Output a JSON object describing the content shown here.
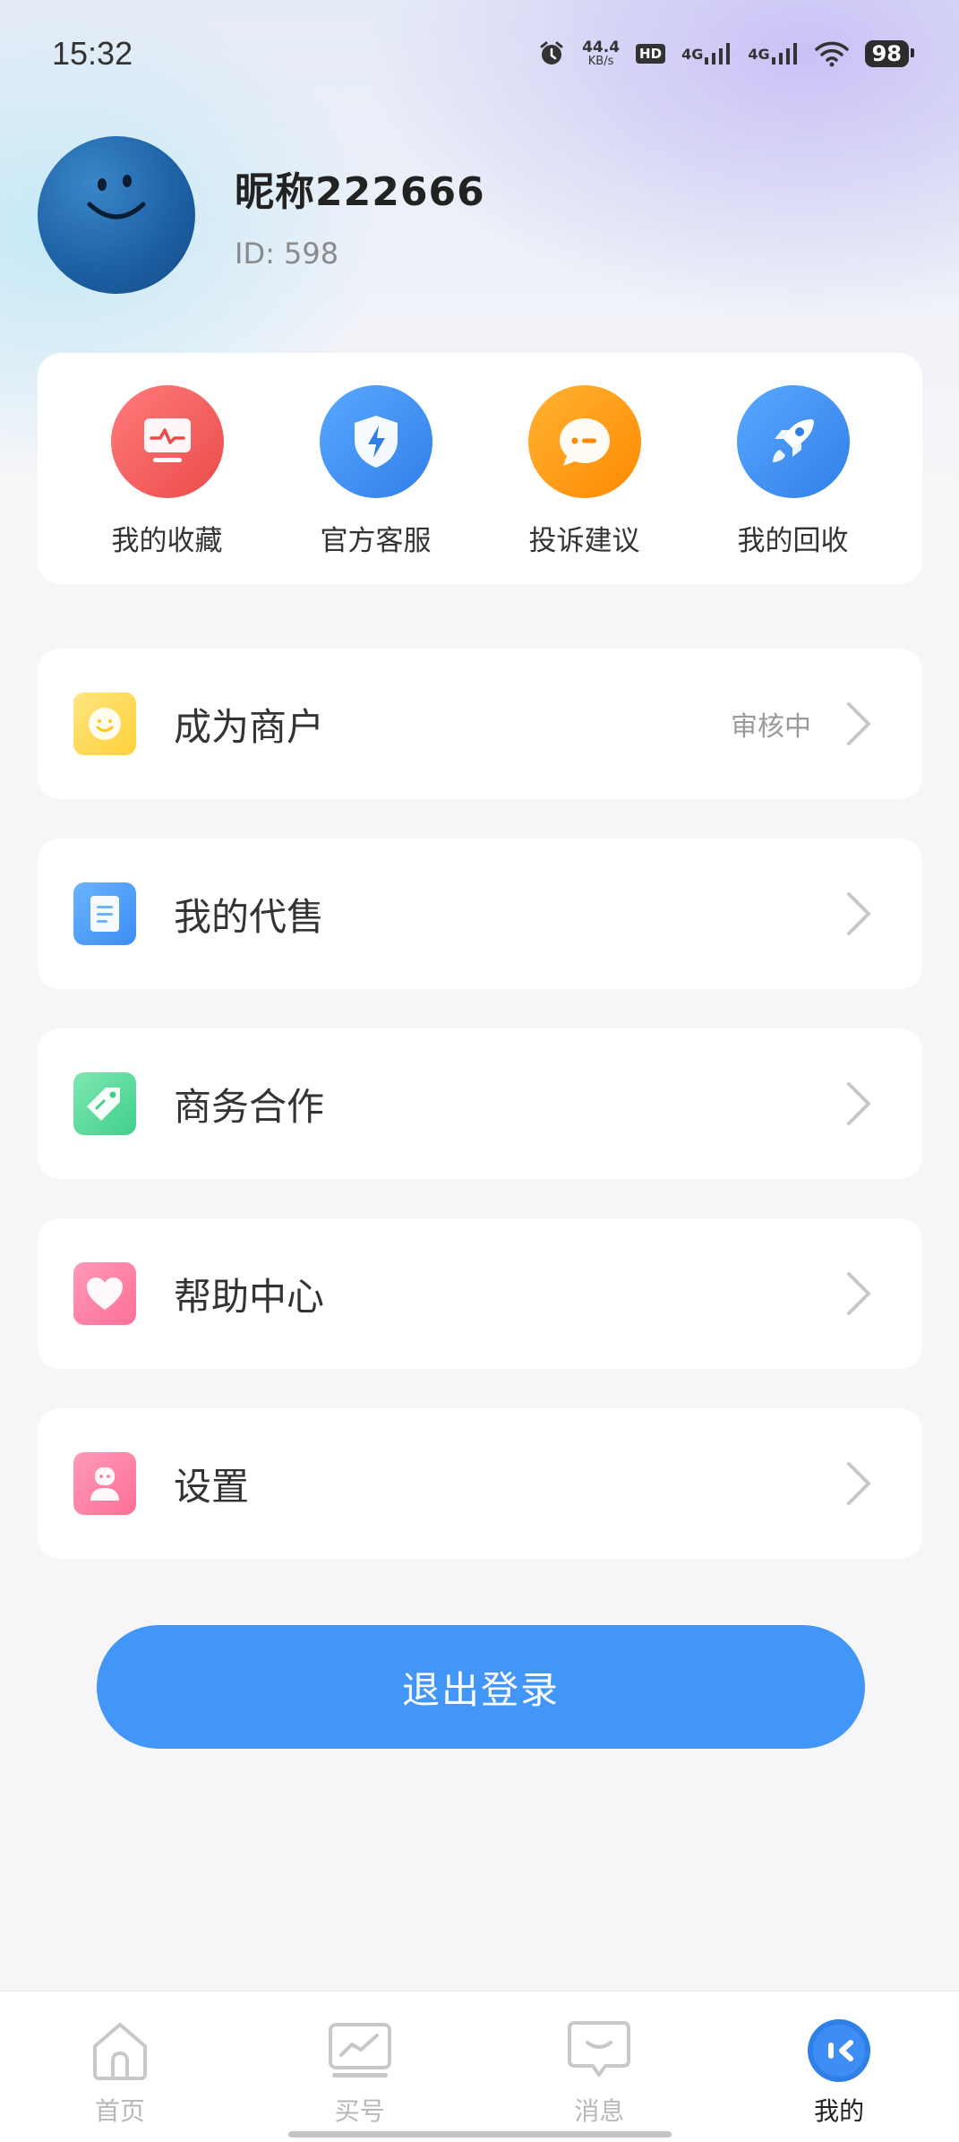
{
  "status_bar": {
    "time": "15:32",
    "net_speed_value": "44.4",
    "net_speed_unit": "KB/s",
    "hd_label": "HD",
    "sig1_label": "4G",
    "sig2_label": "4G",
    "battery": "98"
  },
  "profile": {
    "nickname": "昵称222666",
    "user_id": "ID: 598"
  },
  "quick_actions": [
    {
      "label": "我的收藏",
      "icon": "monitor-icon",
      "color": "#f05a5a"
    },
    {
      "label": "官方客服",
      "icon": "shield-bolt-icon",
      "color": "#3d8df5"
    },
    {
      "label": "投诉建议",
      "icon": "chat-bubble-icon",
      "color": "#ff9c1a"
    },
    {
      "label": "我的回收",
      "icon": "rocket-icon",
      "color": "#3d8df5"
    }
  ],
  "menu": [
    {
      "label": "成为商户",
      "status": "审核中",
      "icon": "smile-icon",
      "color": "#ffd84a"
    },
    {
      "label": "我的代售",
      "status": "",
      "icon": "document-icon",
      "color": "#4b9df5"
    },
    {
      "label": "商务合作",
      "status": "",
      "icon": "tag-icon",
      "color": "#4fd69a"
    },
    {
      "label": "帮助中心",
      "status": "",
      "icon": "heart-icon",
      "color": "#ff7aa0"
    },
    {
      "label": "设置",
      "status": "",
      "icon": "person-icon",
      "color": "#ff7aa0"
    }
  ],
  "logout_label": "退出登录",
  "tabs": [
    {
      "label": "首页",
      "icon": "home-icon",
      "active": false
    },
    {
      "label": "买号",
      "icon": "trend-chart-icon",
      "active": false
    },
    {
      "label": "消息",
      "icon": "message-icon",
      "active": false
    },
    {
      "label": "我的",
      "icon": "profile-face-icon",
      "active": true
    }
  ]
}
